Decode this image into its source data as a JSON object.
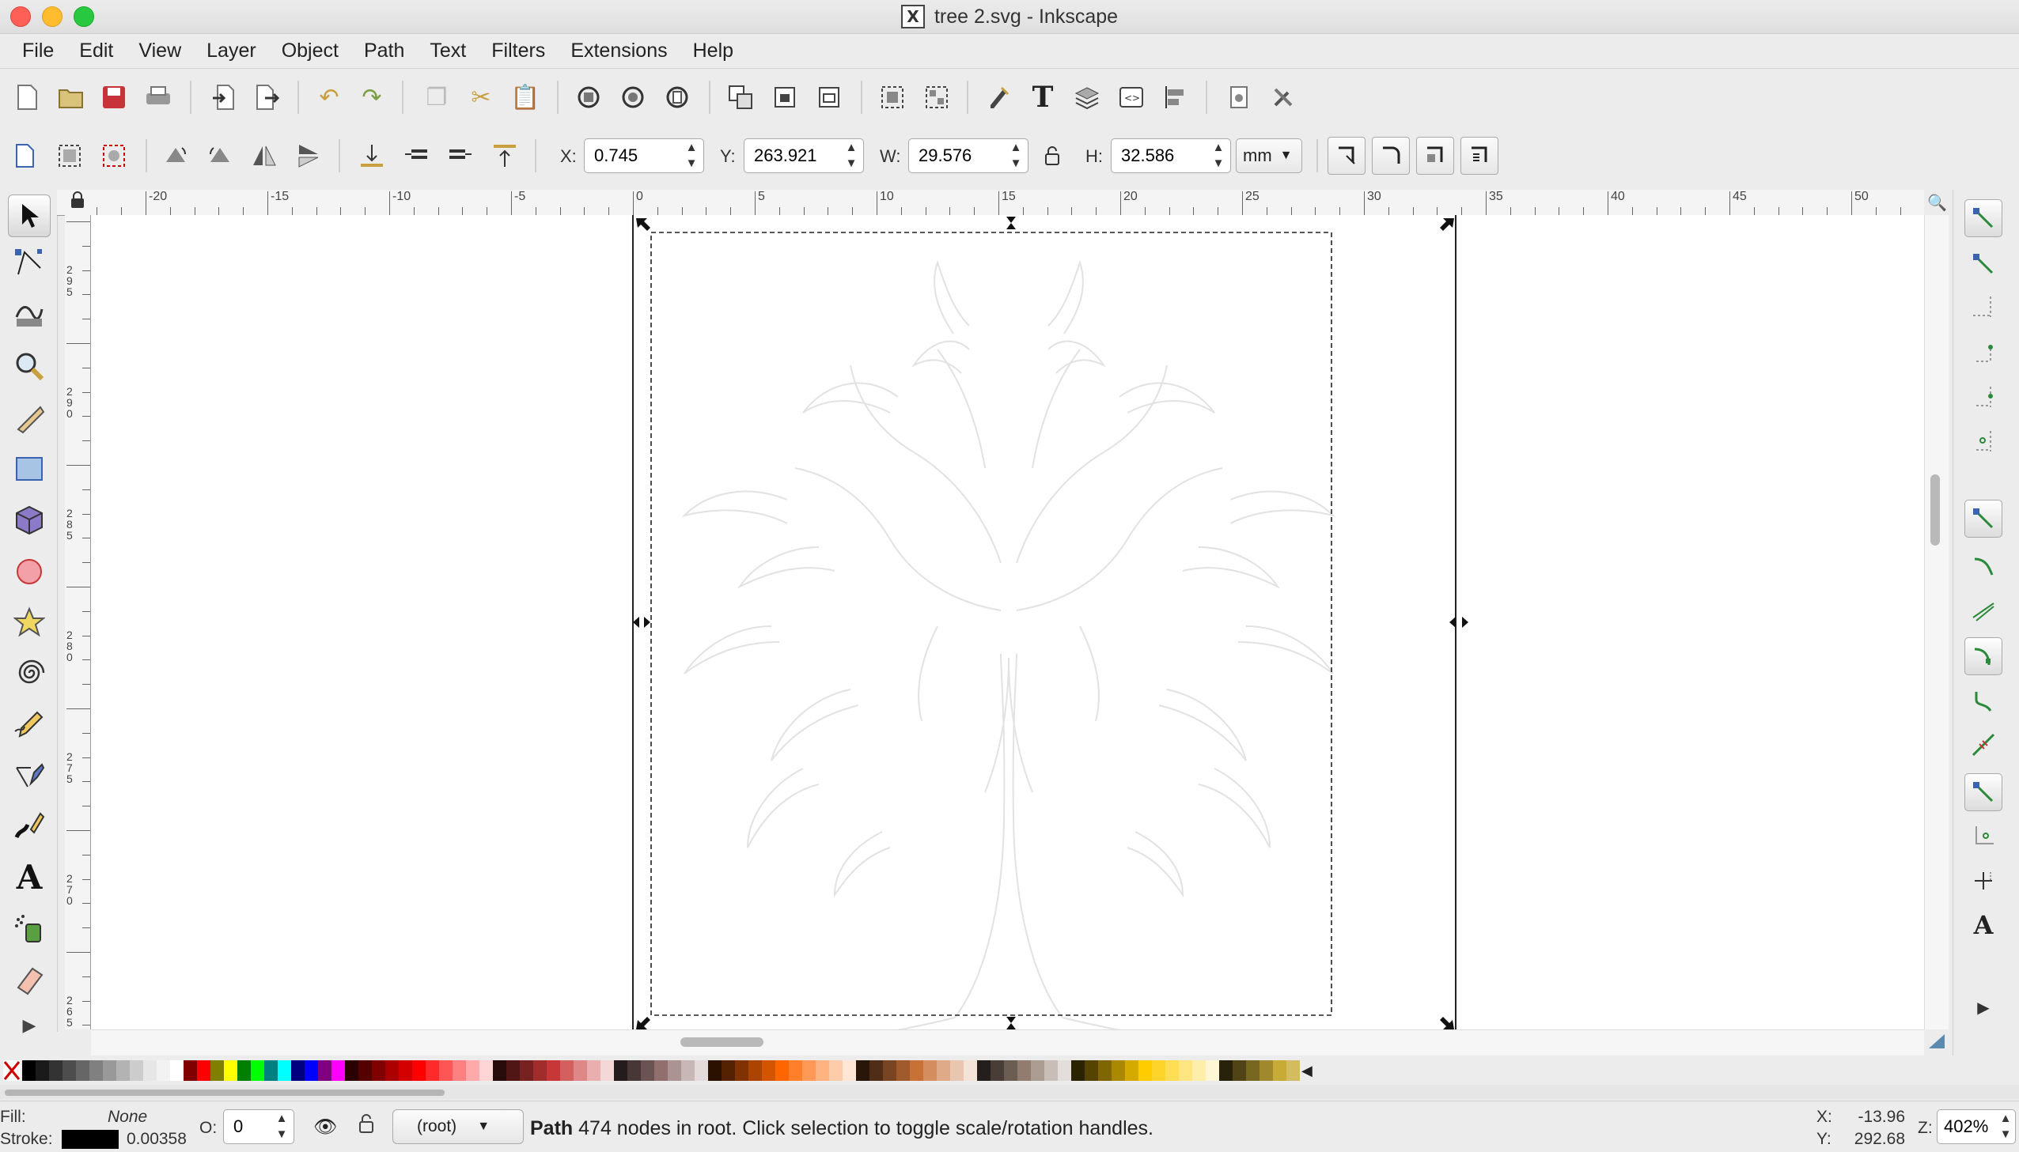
{
  "window": {
    "title": "tree 2.svg - Inkscape",
    "app_icon": "X"
  },
  "menubar": {
    "items": [
      "File",
      "Edit",
      "View",
      "Layer",
      "Object",
      "Path",
      "Text",
      "Filters",
      "Extensions",
      "Help"
    ]
  },
  "command_bar": {
    "icons": [
      "new-icon",
      "open-icon",
      "save-icon",
      "print-icon",
      "import-icon",
      "export-icon",
      "undo-icon",
      "redo-icon",
      "copy-icon",
      "cut-icon",
      "paste-icon",
      "zoom-selection-icon",
      "zoom-drawing-icon",
      "zoom-page-icon",
      "duplicate-icon",
      "clone-icon",
      "unlink-clone-icon",
      "group-icon",
      "ungroup-icon",
      "xml-editor-icon",
      "text-font-icon",
      "layers-icon",
      "objects-icon",
      "align-icon",
      "document-properties-icon",
      "preferences-icon"
    ]
  },
  "select_toolbar": {
    "x_label": "X:",
    "x_value": "0.745",
    "y_label": "Y:",
    "y_value": "263.921",
    "w_label": "W:",
    "w_value": "29.576",
    "h_label": "H:",
    "h_value": "32.586",
    "unit": "mm"
  },
  "rulers": {
    "top_labels": [
      "-20",
      "-15",
      "-10",
      "-5",
      "0",
      "5",
      "10",
      "15",
      "20",
      "25",
      "30",
      "35",
      "40",
      "45",
      "50"
    ],
    "left_labels": [
      "295",
      "290",
      "285",
      "280",
      "275",
      "270",
      "265"
    ]
  },
  "tools": [
    "selector",
    "node",
    "tweak",
    "zoom",
    "measure",
    "rectangle",
    "3d-box",
    "ellipse",
    "star",
    "spiral",
    "pencil",
    "pen",
    "calligraphy",
    "text",
    "spray",
    "eraser"
  ],
  "statusbar": {
    "fill_label": "Fill:",
    "fill_value": "None",
    "stroke_label": "Stroke:",
    "stroke_width": "0.00358",
    "opacity_label": "O:",
    "opacity_value": "0",
    "layer": "(root)",
    "message_bold": "Path",
    "message": "474 nodes in root. Click selection to toggle scale/rotation handles.",
    "cursor_x_label": "X:",
    "cursor_x": "-13.96",
    "cursor_y_label": "Y:",
    "cursor_y": "292.68",
    "zoom_label": "Z:",
    "zoom_value": "402%"
  },
  "colors": {
    "accent_selection": "#000000",
    "snap_green": "#2a8a3a",
    "palette": [
      "#000000",
      "#1a1a1a",
      "#333333",
      "#4d4d4d",
      "#666666",
      "#808080",
      "#999999",
      "#b3b3b3",
      "#cccccc",
      "#e6e6e6",
      "#f2f2f2",
      "#ffffff",
      "#800000",
      "#ff0000",
      "#808000",
      "#ffff00",
      "#008000",
      "#00ff00",
      "#008080",
      "#00ffff",
      "#000080",
      "#0000ff",
      "#800080",
      "#ff00ff",
      "#2b0000",
      "#550000",
      "#800000",
      "#aa0000",
      "#d40000",
      "#ff0000",
      "#ff2a2a",
      "#ff5555",
      "#ff8080",
      "#ffaaaa",
      "#ffd5d5",
      "#280b0b",
      "#501616",
      "#782121",
      "#a02c2c",
      "#c83737",
      "#d35f5f",
      "#de8787",
      "#e9afaf",
      "#f4d7d7",
      "#241c1c",
      "#483737",
      "#6c5353",
      "#916f6f",
      "#ac9393",
      "#c8b7b7",
      "#e3dbdb",
      "#2b1100",
      "#552200",
      "#803300",
      "#aa4400",
      "#d45500",
      "#ff6600",
      "#ff7f2a",
      "#ff9955",
      "#ffb380",
      "#ffccaa",
      "#ffe6d5",
      "#281709",
      "#502d16",
      "#784421",
      "#a05a2c",
      "#c87137",
      "#d38d5f",
      "#deaa87",
      "#e9c6af",
      "#f4e3d7",
      "#241f1c",
      "#483e37",
      "#6c5d53",
      "#917c6f",
      "#ac9d93",
      "#c8beb7",
      "#e3dedb",
      "#2b2200",
      "#554400",
      "#806600",
      "#aa8800",
      "#d4aa00",
      "#ffcc00",
      "#ffd42a",
      "#ffdd55",
      "#ffe680",
      "#ffeeaa",
      "#fff6d5",
      "#28220b",
      "#504416",
      "#786721",
      "#a0892c",
      "#c8ab37",
      "#d3bc5f"
    ]
  }
}
